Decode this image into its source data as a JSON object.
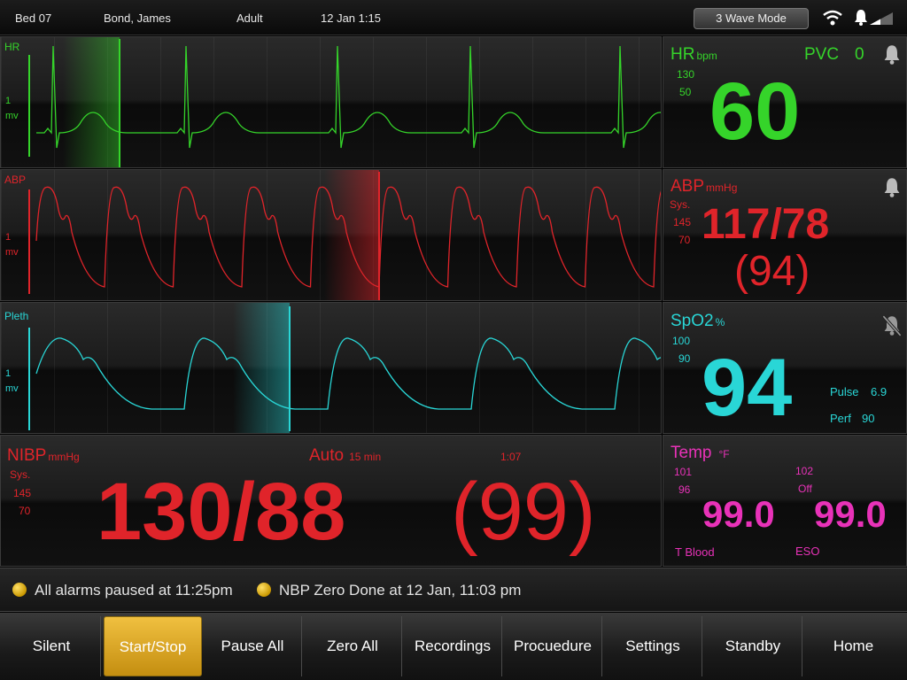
{
  "header": {
    "bed": "Bed 07",
    "patient": "Bond, James",
    "category": "Adult",
    "datetime": "12 Jan 1:15",
    "mode_button": "3 Wave Mode"
  },
  "waves": {
    "hr": {
      "label": "HR",
      "scale_top": "1",
      "scale_unit": "mv",
      "color": "#35d42a"
    },
    "abp": {
      "label": "ABP",
      "scale_top": "1",
      "scale_unit": "mv",
      "color": "#e0242a"
    },
    "pleth": {
      "label": "Pleth",
      "scale_top": "1",
      "scale_unit": "mv",
      "color": "#29d6d6"
    }
  },
  "vitals": {
    "hr": {
      "title": "HR",
      "unit": "bpm",
      "pvc_label": "PVC",
      "pvc_value": "0",
      "upper": "130",
      "lower": "50",
      "value": "60"
    },
    "abp": {
      "title": "ABP",
      "unit": "mmHg",
      "sys_label": "Sys.",
      "upper": "145",
      "lower": "70",
      "value": "117/78",
      "mean": "(94)"
    },
    "spo2": {
      "title": "SpO2",
      "unit": "%",
      "upper": "100",
      "lower": "90",
      "value": "94",
      "pulse_label": "Pulse",
      "pulse_value": "6.9",
      "perf_label": "Perf",
      "perf_value": "90"
    },
    "nibp": {
      "title": "NIBP",
      "unit": "mmHg",
      "sys_label": "Sys.",
      "upper": "145",
      "lower": "70",
      "mode": "Auto",
      "interval": "15 min",
      "timer": "1:07",
      "value": "130/88",
      "mean": "(99)"
    },
    "temp": {
      "title": "Temp",
      "unit": "°F",
      "upper1": "101",
      "lower1": "96",
      "upper2": "102",
      "lower2": "Off",
      "value1": "99.0",
      "value2": "99.0",
      "site1": "T Blood",
      "site2": "ESO"
    }
  },
  "alarms": [
    {
      "text": "All alarms paused at 11:25pm"
    },
    {
      "text": "NBP Zero Done at 12 Jan, 11:03 pm"
    }
  ],
  "buttons": [
    "Silent",
    "Start/Stop",
    "Pause All",
    "Zero All",
    "Recordings",
    "Procuedure",
    "Settings",
    "Standby",
    "Home"
  ],
  "active_button": "Start/Stop",
  "colors": {
    "hr": "#35d42a",
    "abp": "#e0242a",
    "spo2": "#29d6d6",
    "temp": "#e832b8",
    "nibp": "#e0242a",
    "accent": "#e0b030"
  }
}
